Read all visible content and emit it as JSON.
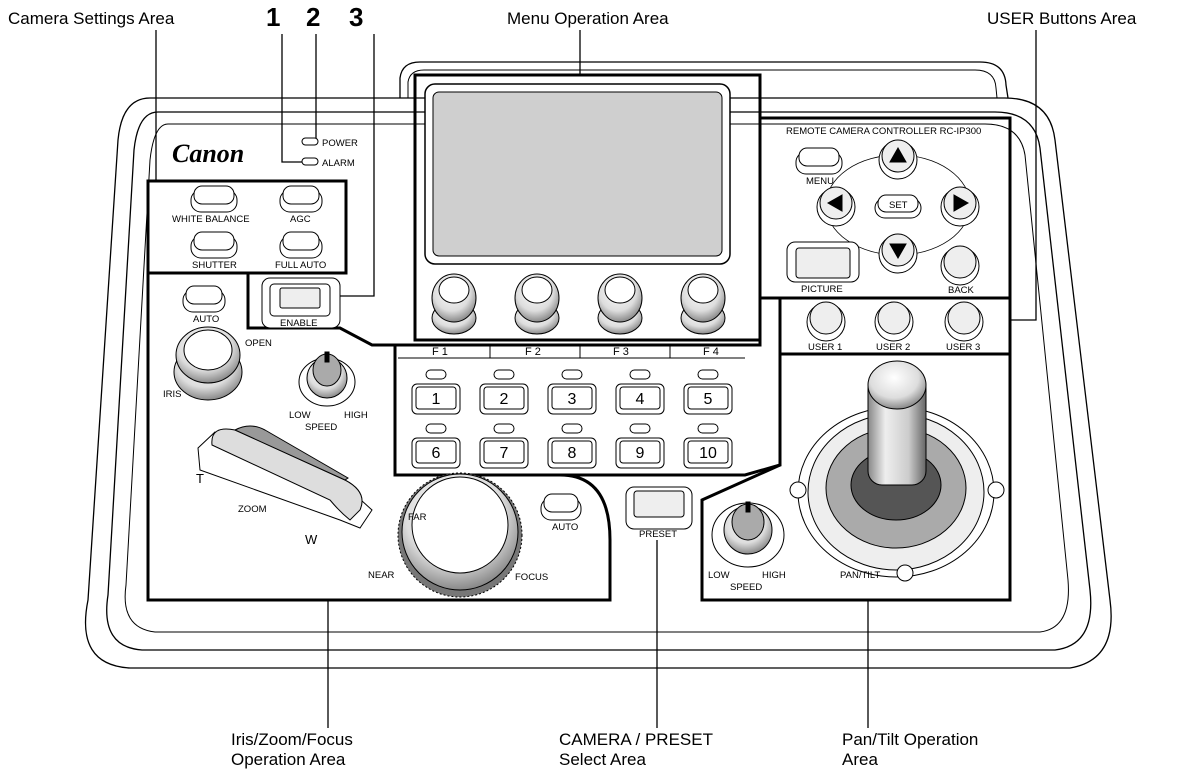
{
  "callouts": {
    "camera_settings": "Camera Settings Area",
    "menu_operation": "Menu Operation Area",
    "user_buttons": "USER Buttons Area",
    "iris_zoom_focus_1": "Iris/Zoom/Focus",
    "iris_zoom_focus_2": "Operation Area",
    "camera_preset_1": "CAMERA / PRESET",
    "camera_preset_2": "Select Area",
    "pan_tilt_1": "Pan/Tilt Operation",
    "pan_tilt_2": "Area",
    "num1": "1",
    "num2": "2",
    "num3": "3"
  },
  "panel": {
    "brand": "Canon",
    "model": "REMOTE CAMERA CONTROLLER  RC-IP300",
    "power": "POWER",
    "alarm": "ALARM",
    "white_balance": "WHITE BALANCE",
    "agc": "AGC",
    "shutter": "SHUTTER",
    "full_auto": "FULL AUTO",
    "enable": "ENABLE",
    "auto_iris": "AUTO",
    "open": "OPEN",
    "iris": "IRIS",
    "low": "LOW",
    "high": "HIGH",
    "speed": "SPEED",
    "t": "T",
    "w": "W",
    "zoom": "ZOOM",
    "far": "FAR",
    "near": "NEAR",
    "focus": "FOCUS",
    "auto_focus": "AUTO",
    "menu": "MENU",
    "set": "SET",
    "picture": "PICTURE",
    "back": "BACK",
    "user1": "USER 1",
    "user2": "USER 2",
    "user3": "USER 3",
    "f1": "F 1",
    "f2": "F 2",
    "f3": "F 3",
    "f4": "F 4",
    "keys": [
      "1",
      "2",
      "3",
      "4",
      "5",
      "6",
      "7",
      "8",
      "9",
      "10"
    ],
    "preset": "PRESET",
    "pan_tilt": "PAN/TILT",
    "pt_low": "LOW",
    "pt_high": "HIGH",
    "pt_speed": "SPEED"
  }
}
